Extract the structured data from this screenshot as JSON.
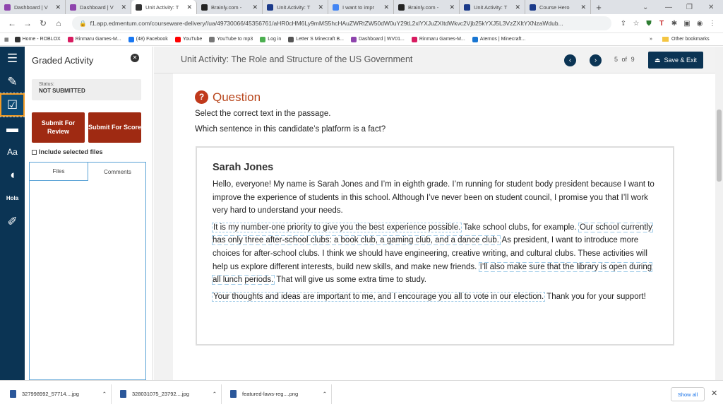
{
  "browser": {
    "tabs": [
      {
        "title": "Dashboard | V",
        "color": "#8e44ad"
      },
      {
        "title": "Dashboard | V",
        "color": "#8e44ad"
      },
      {
        "title": "Unit Activity: T",
        "color": "#333333",
        "active": true
      },
      {
        "title": "Brainly.com -",
        "color": "#222222"
      },
      {
        "title": "Unit Activity: T",
        "color": "#1b3a8a"
      },
      {
        "title": "I want to impr",
        "color": "#4285f4"
      },
      {
        "title": "Brainly.com -",
        "color": "#222222"
      },
      {
        "title": "Unit Activity: T",
        "color": "#1b3a8a"
      },
      {
        "title": "Course Hero",
        "color": "#1b3a8a"
      }
    ],
    "new_tab": "+",
    "url": "f1.app.edmentum.com/courseware-delivery//ua/49730066/45356761/aHR0cHM6Ly9mMS5hcHAuZWRtZW50dW0uY29tL2xlYXJuZXItdWkvc2Vjb25kYXJ5L3VzZXItYXNzaWdub...",
    "bookmarks": [
      {
        "label": "Home - ROBLOX",
        "color": "#333333"
      },
      {
        "label": "Rinmaru Games-M...",
        "color": "#d81b60"
      },
      {
        "label": "(48) Facebook",
        "color": "#1877f2"
      },
      {
        "label": "YouTube",
        "color": "#ff0000"
      },
      {
        "label": "YouTube to mp3",
        "color": "#777777"
      },
      {
        "label": "Log in",
        "color": "#4caf50"
      },
      {
        "label": "Letter S Minecraft B...",
        "color": "#555555"
      },
      {
        "label": "Dashboard | WV01...",
        "color": "#8e44ad"
      },
      {
        "label": "Rinmaru Games-M...",
        "color": "#d81b60"
      },
      {
        "label": "Aternos | Minecraft...",
        "color": "#1976d2"
      }
    ],
    "other_bookmarks": "Other bookmarks"
  },
  "panel": {
    "title": "Graded Activity",
    "status_label": "Status:",
    "status_value": "NOT SUBMITTED",
    "submit_review": "Submit For Review",
    "submit_score": "Submit For Score",
    "include_files": "Include selected files",
    "tab_files": "Files",
    "tab_comments": "Comments"
  },
  "header": {
    "title": "Unit Activity: The Role and Structure of the US Government",
    "page_current": "5",
    "page_of": "of",
    "page_total": "9",
    "save_exit": "Save & Exit"
  },
  "question": {
    "label": "Question",
    "instruction": "Select the correct text in the passage.",
    "prompt": "Which sentence in this candidate’s platform is a fact?"
  },
  "passage": {
    "name": "Sarah Jones",
    "p1": "Hello, everyone! My name is Sarah Jones and I’m in eighth grade. I’m running for student body president because I want to improve the experience of students in this school. Although I’ve never been on student council, I promise you that I’ll work very hard to understand your needs.",
    "s1": "It is my number-one priority to give you the best experience possible.",
    "t1": "Take school clubs, for example.",
    "s2": "Our school currently has only three after-school clubs: a book club, a gaming club, and a dance club.",
    "t2": "As president, I want to introduce more choices for after-school clubs. I think we should have engineering, creative writing, and cultural clubs. These activities will help us explore different interests, build new skills, and make new friends.",
    "s3": "I’ll also make sure that the library is open during all lunch periods.",
    "t3": "That will give us some extra time to study.",
    "s4": "Your thoughts and ideas are important to me, and I encourage you all to vote in our election.",
    "t4": "Thank you for your support!"
  },
  "downloads": {
    "items": [
      "327998992_57714....jpg",
      "328031075_23792....jpg",
      "featured-laws-reg....png"
    ],
    "show_all": "Show all"
  }
}
